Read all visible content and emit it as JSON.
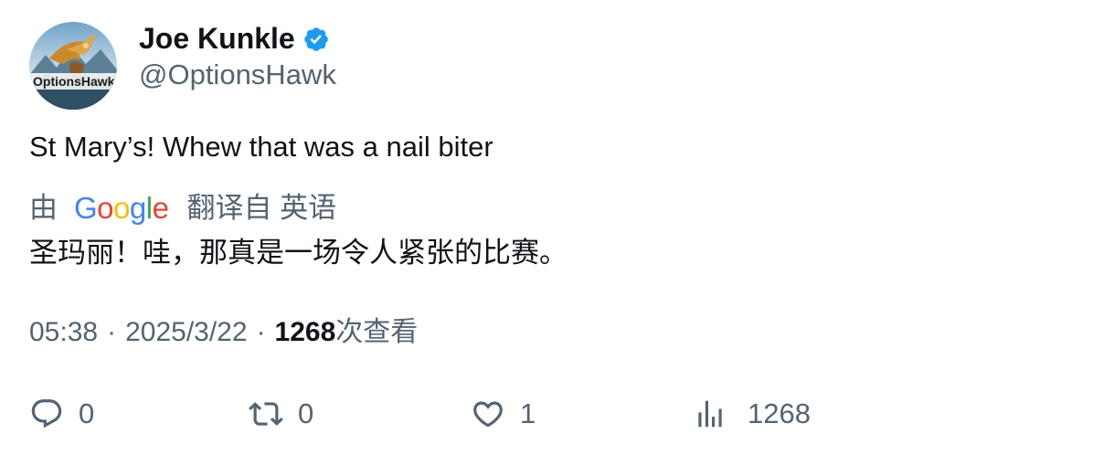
{
  "author": {
    "name": "Joe Kunkle",
    "handle": "@OptionsHawk",
    "avatar_text": "OptionsHawk",
    "verified_color": "#1d9bf0"
  },
  "tweet": {
    "text": "St Mary’s! Whew that was a nail biter"
  },
  "translation": {
    "prefix": "由",
    "provider_letters": [
      "G",
      "o",
      "o",
      "g",
      "l",
      "e"
    ],
    "suffix": "翻译自 英语",
    "text": "圣玛丽！哇，那真是一场令人紧张的比赛。"
  },
  "meta": {
    "time": "05:38",
    "date": "2025/3/22",
    "separator": "·",
    "views_count": "1268",
    "views_label": "次查看"
  },
  "actions": {
    "reply_count": "0",
    "retweet_count": "0",
    "like_count": "1",
    "view_count": "1268"
  },
  "icons": {
    "reply": "reply-icon",
    "retweet": "retweet-icon",
    "like": "heart-icon",
    "analytics": "analytics-icon",
    "verified": "verified-badge-icon"
  },
  "colors": {
    "text_primary": "#0f1419",
    "text_secondary": "#536471",
    "google_blue": "#4285F4",
    "google_red": "#EA4335",
    "google_yellow": "#FBBC05",
    "google_green": "#34A853"
  }
}
